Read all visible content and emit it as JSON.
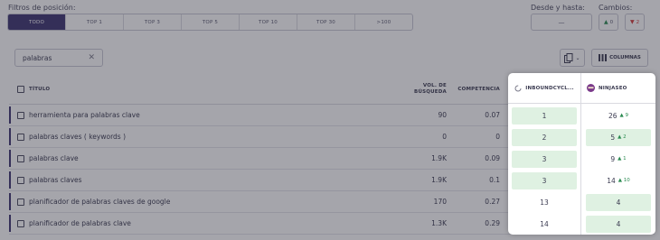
{
  "filters": {
    "position_label": "Filtros de posición:",
    "position_options": [
      "TODO",
      "TOP 1",
      "TOP 3",
      "TOP 5",
      "TOP 10",
      "TOP 30",
      ">100"
    ],
    "active_option": "TODO",
    "date_label": "Desde y hasta:",
    "date_value": "—",
    "changes_label": "Cambios:",
    "change_up": "0",
    "change_down": "2"
  },
  "search": {
    "value": "palabras",
    "clear_icon": "close-icon"
  },
  "toolbar": {
    "copy_icon": "copy-icon",
    "columns_label": "COLUMNAS",
    "columns_icon": "columns-icon"
  },
  "table": {
    "headers": {
      "title": "TÍTULO",
      "volume": "VOL. DE BÚSQUEDA",
      "volume_line1": "VOL. DE",
      "volume_line2": "BÚSQUEDA",
      "competition": "COMPETENCIA",
      "competitor1": "INBOUNDCYCL...",
      "competitor2": "NINJASEO"
    },
    "rows": [
      {
        "title": "herramienta para palabras clave",
        "volume": "90",
        "competition": "0.07",
        "inbound": "1",
        "ninja": "26",
        "ninja_delta": "9"
      },
      {
        "title": "palabras claves ( keywords )",
        "volume": "0",
        "competition": "0",
        "inbound": "2",
        "ninja": "5",
        "ninja_delta": "2"
      },
      {
        "title": "palabras clave",
        "volume": "1.9K",
        "competition": "0.09",
        "inbound": "3",
        "ninja": "9",
        "ninja_delta": "1"
      },
      {
        "title": "palabras claves",
        "volume": "1.9K",
        "competition": "0.1",
        "inbound": "3",
        "ninja": "14",
        "ninja_delta": "10"
      },
      {
        "title": "planificador de palabras claves de google",
        "volume": "170",
        "competition": "0.27",
        "inbound": "13",
        "ninja": "4",
        "ninja_delta": ""
      },
      {
        "title": "planificador de palabras clave",
        "volume": "1.3K",
        "competition": "0.29",
        "inbound": "14",
        "ninja": "4",
        "ninja_delta": ""
      }
    ]
  },
  "colors": {
    "accent": "#3d3570",
    "positive": "#2a8a50",
    "negative": "#d23c3c",
    "highlight": "#dff1e2"
  }
}
